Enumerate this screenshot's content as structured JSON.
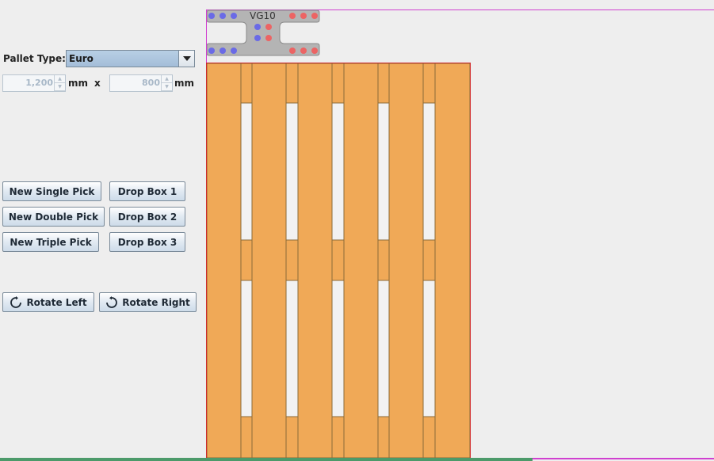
{
  "pallet": {
    "type_label": "Pallet Type:",
    "type_value": "Euro",
    "width_value": "1,200",
    "length_value": "800",
    "unit": "mm",
    "times": "x"
  },
  "buttons": {
    "new_single": "New Single Pick",
    "new_double": "New Double Pick",
    "new_triple": "New Triple Pick",
    "drop_box_1": "Drop Box 1",
    "drop_box_2": "Drop Box 2",
    "drop_box_3": "Drop Box 3",
    "rotate_left": "Rotate Left",
    "rotate_right": "Rotate Right"
  },
  "gripper": {
    "label": "VG10"
  },
  "colors": {
    "pallet_wood": "#f0a957",
    "pallet_outline": "#d12a2a",
    "gripper_body": "#b4b4b4",
    "dot_blue": "#6a6ae6",
    "dot_red": "#ec6464"
  }
}
